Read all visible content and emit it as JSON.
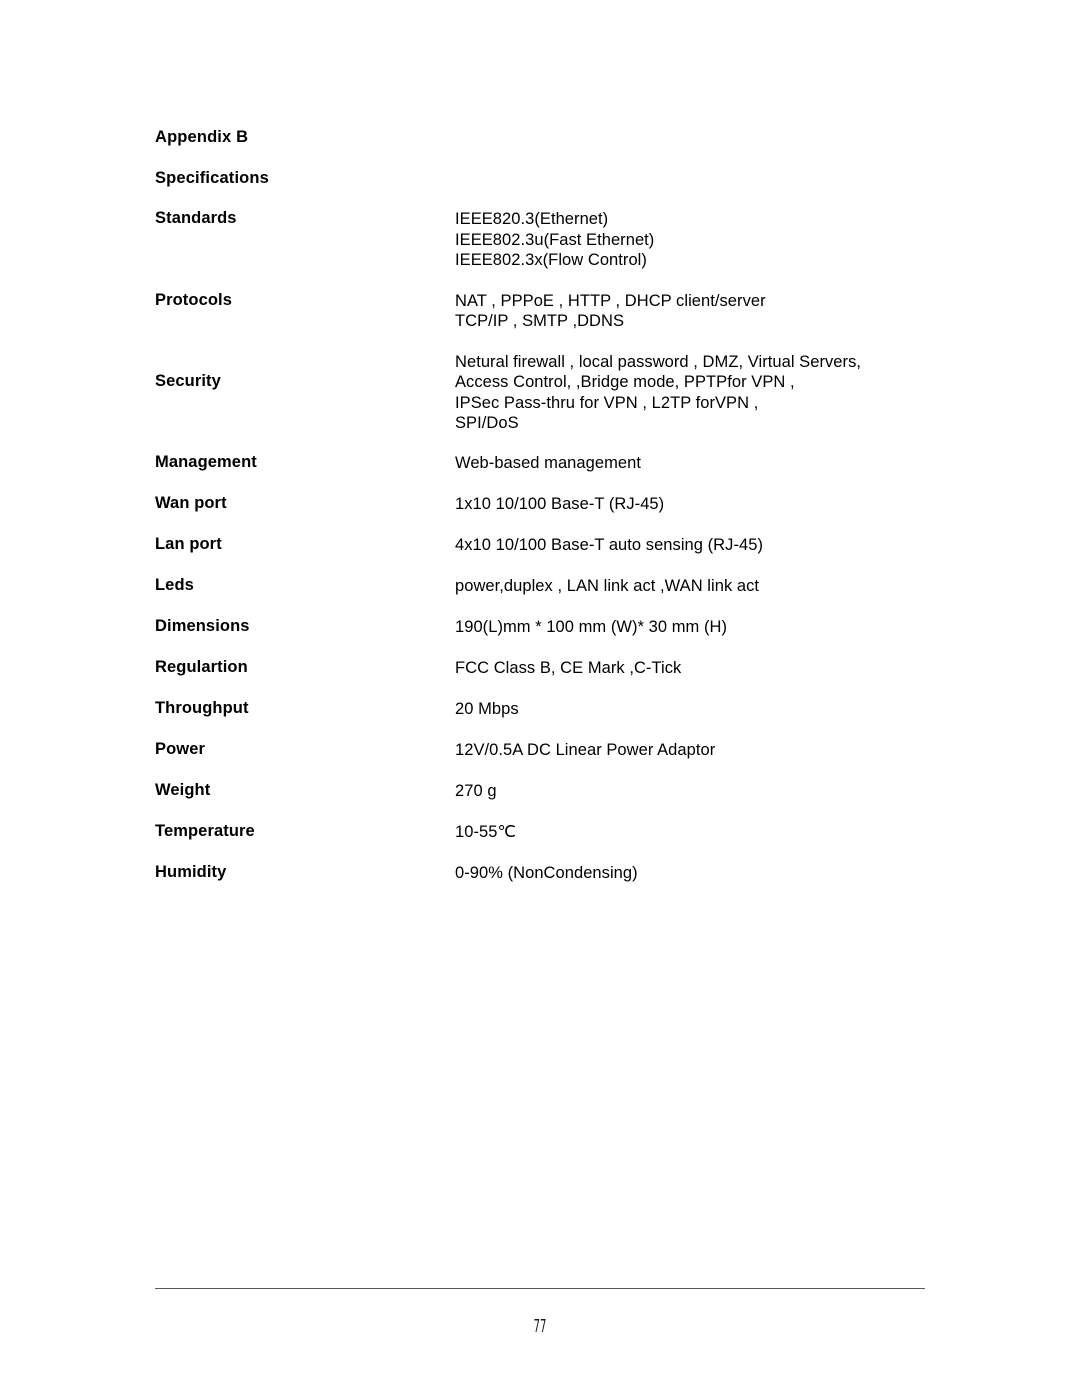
{
  "document": {
    "appendix_title": "Appendix B",
    "section_title": "Specifications",
    "page_number": "77"
  },
  "specifications": [
    {
      "label": "Standards",
      "value": "IEEE820.3(Ethernet)\nIEEE802.3u(Fast Ethernet)\nIEEE802.3x(Flow Control)",
      "lines": 3
    },
    {
      "label": "Protocols",
      "value": "NAT , PPPoE , HTTP , DHCP client/server\nTCP/IP , SMTP ,DDNS",
      "lines": 2
    },
    {
      "label": "Security",
      "value": "Netural firewall , local password , DMZ, Virtual Servers,\nAccess Control, ,Bridge mode, PPTPfor VPN ,\nIPSec  Pass-thru for VPN ,  L2TP forVPN ,\nSPI/DoS",
      "lines": 4
    },
    {
      "label": "Management",
      "value": "Web-based management",
      "lines": 1
    },
    {
      "label": "Wan port",
      "value": "1x10 10/100  Base-T (RJ-45)",
      "lines": 1
    },
    {
      "label": "Lan port",
      "value": "4x10 10/100  Base-T auto sensing   (RJ-45)",
      "lines": 1
    },
    {
      "label": "Leds",
      "value": "power,duplex , LAN link act ,WAN link act",
      "lines": 1
    },
    {
      "label": "Dimensions",
      "value": "190(L)mm * 100 mm (W)* 30 mm (H)",
      "lines": 1
    },
    {
      "label": "Regulartion",
      "value": "FCC Class B, CE Mark ,C-Tick",
      "lines": 1
    },
    {
      "label": "Throughput",
      "value": "20 Mbps",
      "lines": 1
    },
    {
      "label": "Power",
      "value": "12V/0.5A DC Linear Power Adaptor",
      "lines": 1
    },
    {
      "label": "Weight",
      "value": "270 g",
      "lines": 1
    },
    {
      "label": "Temperature",
      "value": "10-55℃",
      "lines": 1
    },
    {
      "label": "Humidity",
      "value": "0-90% (NonCondensing)",
      "lines": 1
    }
  ],
  "colors": {
    "page_background": "#ffffff",
    "text": "#000000",
    "footer_rule": "#595959"
  }
}
